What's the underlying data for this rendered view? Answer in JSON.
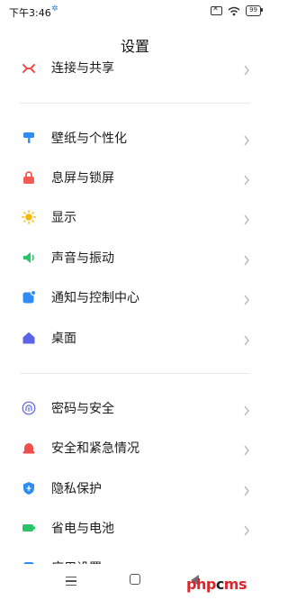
{
  "status_bar": {
    "time": "下午3:46",
    "battery": "99"
  },
  "header": {
    "title": "设置"
  },
  "items": [
    {
      "label": "连接与共享",
      "icon": "share-icon",
      "color": "#f04e4e"
    },
    {
      "label": "壁纸与个性化",
      "icon": "wallpaper-icon",
      "color": "#2f8cf5"
    },
    {
      "label": "息屏与锁屏",
      "icon": "lock-icon",
      "color": "#f25c54"
    },
    {
      "label": "显示",
      "icon": "sun-icon",
      "color": "#f5b800"
    },
    {
      "label": "声音与振动",
      "icon": "speaker-icon",
      "color": "#2cc26a"
    },
    {
      "label": "通知与控制中心",
      "icon": "notification-icon",
      "color": "#2f8cf5"
    },
    {
      "label": "桌面",
      "icon": "home-icon",
      "color": "#5b63e6"
    },
    {
      "label": "密码与安全",
      "icon": "fingerprint-icon",
      "color": "#5b63e6"
    },
    {
      "label": "安全和紧急情况",
      "icon": "emergency-icon",
      "color": "#f04e4e"
    },
    {
      "label": "隐私保护",
      "icon": "privacy-shield-icon",
      "color": "#2f8cf5"
    },
    {
      "label": "省电与电池",
      "icon": "battery-icon",
      "color": "#2cc26a"
    },
    {
      "label": "应用设置",
      "icon": "apps-icon",
      "color": "#2f8cf5"
    }
  ],
  "watermark": {
    "red1": "php",
    "dark": "c",
    "red2": "ms"
  }
}
